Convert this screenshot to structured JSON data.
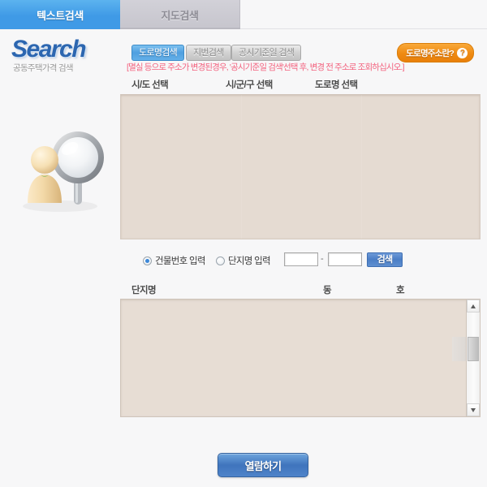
{
  "tabs": [
    {
      "label": "텍스트검색",
      "active": true
    },
    {
      "label": "지도검색",
      "active": false
    }
  ],
  "brand": {
    "title": "Search",
    "subtitle": "공동주택가격 검색"
  },
  "mode_buttons": [
    {
      "label": "도로명검색",
      "active": true
    },
    {
      "label": "지번검색",
      "active": false
    },
    {
      "label": "공시기준일 검색",
      "active": false
    }
  ],
  "help_button": {
    "label": "도로명주소란?",
    "icon": "question-mark-icon",
    "glyph": "?",
    "color": "#ef8a12"
  },
  "notice": "[멸실 등으로 주소가 변경된경우, '공시기준일 검색'선택 후, 변경 전 주소로 조회하십시오.]",
  "notice_color": "#f3637f",
  "selector_headers": [
    "시/도 선택",
    "시/군/구 선택",
    "도로명 선택"
  ],
  "selector_panel": {
    "background": "#e5dbd2",
    "sido_options": [],
    "sigungu_options": [],
    "road_options": []
  },
  "search_row": {
    "radios": [
      {
        "label": "건물번호 입력",
        "checked": true
      },
      {
        "label": "단지명 입력",
        "checked": false
      }
    ],
    "input_from": {
      "value": "",
      "placeholder": ""
    },
    "separator": "-",
    "input_to": {
      "value": "",
      "placeholder": ""
    },
    "search_label": "검색"
  },
  "result_headers": [
    "단지명",
    "동",
    "호"
  ],
  "result_panel": {
    "background": "#e7ddd4",
    "rows": [],
    "scrollbar": {
      "up_icon": "chevron-up-icon",
      "down_icon": "chevron-down-icon"
    }
  },
  "action": {
    "view_label": "열람하기"
  },
  "mascot": {
    "icon": "person-with-magnifier-icon"
  }
}
